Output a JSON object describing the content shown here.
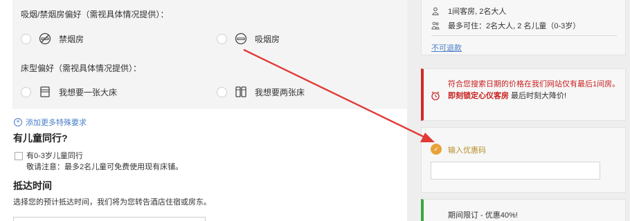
{
  "smoking": {
    "label": "吸烟/禁烟房偏好（需视具体情况提供）：",
    "options": [
      {
        "label": "禁烟房",
        "icon": "no-smoking-icon"
      },
      {
        "label": "吸烟房",
        "icon": "smoking-icon"
      }
    ]
  },
  "bed": {
    "label": "床型偏好（需视具体情况提供）：",
    "options": [
      {
        "label": "我想要一张大床",
        "icon": "double-bed-icon"
      },
      {
        "label": "我想要两张床",
        "icon": "twin-bed-icon"
      }
    ]
  },
  "add_more": "添加更多特殊要求",
  "children": {
    "heading": "有儿童同行?",
    "checkbox_label": "有0-3岁儿童同行",
    "note": "敬请注意：最多2名儿童可免费使用现有床铺。"
  },
  "arrival": {
    "heading": "抵达时间",
    "desc": "选择您的预计抵达时间，我们将为您转告酒店住宿或房东。"
  },
  "room_info": {
    "rooms": "1间客房, 2名大人",
    "max": "最多可住：2名大人, 2 名儿童（0-3岁）",
    "refund": "不可退款"
  },
  "alert": {
    "line1": "符合您搜索日期的价格在我们网站仅有最后1间房。",
    "line2_bold": "即刻锁定心仪客房",
    "line2_plain": " 最后时刻大降价!"
  },
  "promo": {
    "label": "输入优惠码"
  },
  "deal": {
    "text": "期间限订 - 优惠40%!"
  },
  "colors": {
    "link": "#4a7ec8",
    "alert": "#d22a2a",
    "deal": "#3aa83a",
    "arrow": "#e03a36"
  }
}
